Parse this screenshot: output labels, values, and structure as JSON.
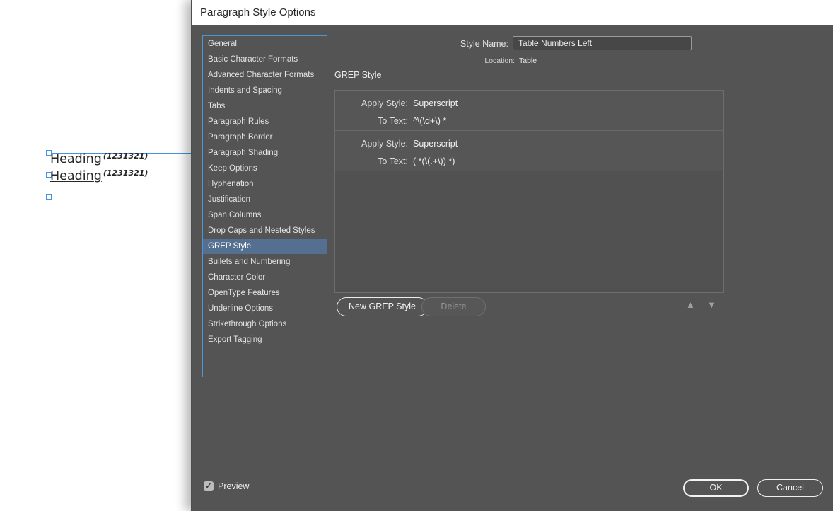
{
  "document": {
    "headings": [
      {
        "word": "Heading",
        "superscript": "(1231321)",
        "underlined": false
      },
      {
        "word": "Heading",
        "superscript": "(1231321)",
        "underlined": true
      }
    ]
  },
  "dialog": {
    "title": "Paragraph Style Options",
    "style_name": {
      "label": "Style Name:",
      "value": "Table Numbers Left"
    },
    "location": {
      "label": "Location:",
      "value": "Table"
    },
    "sidebar": {
      "items": [
        "General",
        "Basic Character Formats",
        "Advanced Character Formats",
        "Indents and Spacing",
        "Tabs",
        "Paragraph Rules",
        "Paragraph Border",
        "Paragraph Shading",
        "Keep Options",
        "Hyphenation",
        "Justification",
        "Span Columns",
        "Drop Caps and Nested Styles",
        "GREP Style",
        "Bullets and Numbering",
        "Character Color",
        "OpenType Features",
        "Underline Options",
        "Strikethrough Options",
        "Export Tagging"
      ],
      "selected": "GREP Style"
    },
    "grep_panel": {
      "heading": "GREP Style",
      "apply_style_label": "Apply Style:",
      "to_text_label": "To Text:",
      "rules": [
        {
          "apply_style": "Superscript",
          "to_text": "^\\(\\d+\\) *"
        },
        {
          "apply_style": "Superscript",
          "to_text": "( *(\\(.+\\)) *)"
        }
      ]
    },
    "buttons": {
      "new_grep_style": "New GREP Style",
      "delete": "Delete",
      "ok": "OK",
      "cancel": "Cancel"
    },
    "preview": {
      "label": "Preview",
      "checked": true
    },
    "icons": {
      "move_up": "▲",
      "move_down": "▼",
      "check": "✓"
    }
  },
  "colors": {
    "dialog_bg": "#545454",
    "titlebar_bg": "#ffffff",
    "sidebar_border": "#4a96d8",
    "sidebar_selected_bg": "#556f90",
    "frame_blue": "#4a90e2",
    "guide_purple": "#a352d8"
  }
}
